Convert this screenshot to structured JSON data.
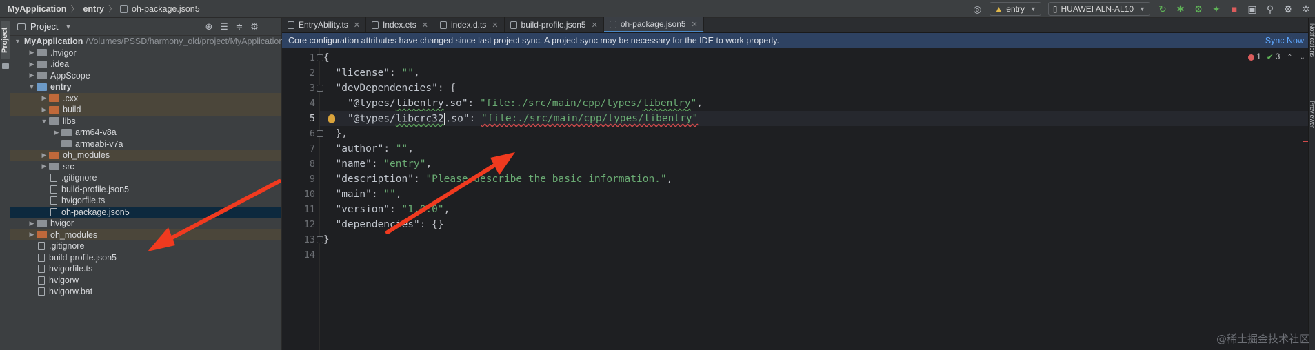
{
  "breadcrumb": {
    "project": "MyApplication",
    "module": "entry",
    "file": "oh-package.json5"
  },
  "toolbar": {
    "module_select": "entry",
    "device_select": "HUAWEI ALN-AL10"
  },
  "side_strip": {
    "label": "Project"
  },
  "project_panel": {
    "title": "Project"
  },
  "tree": [
    {
      "indent": 0,
      "arrow": "down",
      "icon": "folder-b",
      "label": "MyApplication",
      "path": "/Volumes/PSSD/harmony_old/project/MyApplication",
      "bold": true,
      "state": ""
    },
    {
      "indent": 1,
      "arrow": "right",
      "icon": "folder",
      "label": ".hvigor",
      "state": ""
    },
    {
      "indent": 1,
      "arrow": "right",
      "icon": "folder",
      "label": ".idea",
      "state": ""
    },
    {
      "indent": 1,
      "arrow": "right",
      "icon": "folder",
      "label": "AppScope",
      "state": ""
    },
    {
      "indent": 1,
      "arrow": "down",
      "icon": "folder-b",
      "label": "entry",
      "bold": true,
      "state": ""
    },
    {
      "indent": 2,
      "arrow": "right",
      "icon": "folder-o",
      "label": ".cxx",
      "state": "hl"
    },
    {
      "indent": 2,
      "arrow": "right",
      "icon": "folder-o",
      "label": "build",
      "state": "hl"
    },
    {
      "indent": 2,
      "arrow": "down",
      "icon": "folder",
      "label": "libs",
      "state": ""
    },
    {
      "indent": 3,
      "arrow": "right",
      "icon": "folder",
      "label": "arm64-v8a",
      "state": ""
    },
    {
      "indent": 3,
      "arrow": "",
      "icon": "folder",
      "label": "armeabi-v7a",
      "state": ""
    },
    {
      "indent": 2,
      "arrow": "right",
      "icon": "folder-o",
      "label": "oh_modules",
      "state": "hl"
    },
    {
      "indent": 2,
      "arrow": "right",
      "icon": "folder",
      "label": "src",
      "state": ""
    },
    {
      "indent": 2,
      "arrow": "",
      "icon": "file",
      "label": ".gitignore",
      "state": ""
    },
    {
      "indent": 2,
      "arrow": "",
      "icon": "file",
      "label": "build-profile.json5",
      "state": ""
    },
    {
      "indent": 2,
      "arrow": "",
      "icon": "file",
      "label": "hvigorfile.ts",
      "state": ""
    },
    {
      "indent": 2,
      "arrow": "",
      "icon": "file",
      "label": "oh-package.json5",
      "state": "sel"
    },
    {
      "indent": 1,
      "arrow": "right",
      "icon": "folder",
      "label": "hvigor",
      "state": ""
    },
    {
      "indent": 1,
      "arrow": "right",
      "icon": "folder-o",
      "label": "oh_modules",
      "state": "hl"
    },
    {
      "indent": 1,
      "arrow": "",
      "icon": "file",
      "label": ".gitignore",
      "state": ""
    },
    {
      "indent": 1,
      "arrow": "",
      "icon": "file",
      "label": "build-profile.json5",
      "state": ""
    },
    {
      "indent": 1,
      "arrow": "",
      "icon": "file",
      "label": "hvigorfile.ts",
      "state": ""
    },
    {
      "indent": 1,
      "arrow": "",
      "icon": "file",
      "label": "hvigorw",
      "state": ""
    },
    {
      "indent": 1,
      "arrow": "",
      "icon": "file",
      "label": "hvigorw.bat",
      "state": ""
    }
  ],
  "tabs": [
    {
      "label": "EntryAbility.ts",
      "active": false
    },
    {
      "label": "Index.ets",
      "active": false
    },
    {
      "label": "index.d.ts",
      "active": false
    },
    {
      "label": "build-profile.json5",
      "active": false
    },
    {
      "label": "oh-package.json5",
      "active": true
    }
  ],
  "banner": {
    "message": "Core configuration attributes have changed since last project sync. A project sync may be necessary for the IDE to work properly.",
    "action": "Sync Now"
  },
  "inspections": {
    "errors": "1",
    "ok": "3"
  },
  "code_lines": [
    {
      "n": "1",
      "text": "{"
    },
    {
      "n": "2",
      "text": "  \"license\": \"\","
    },
    {
      "n": "3",
      "text": "  \"devDependencies\": {"
    },
    {
      "n": "4",
      "text": "    \"@types/libentry.so\": \"file:./src/main/cpp/types/libentry\","
    },
    {
      "n": "5",
      "text": "    \"@types/libcrc32.so\": \"file:./src/main/cpp/types/libentry\""
    },
    {
      "n": "6",
      "text": "  },"
    },
    {
      "n": "7",
      "text": "  \"author\": \"\","
    },
    {
      "n": "8",
      "text": "  \"name\": \"entry\","
    },
    {
      "n": "9",
      "text": "  \"description\": \"Please describe the basic information.\","
    },
    {
      "n": "10",
      "text": "  \"main\": \"\","
    },
    {
      "n": "11",
      "text": "  \"version\": \"1.0.0\","
    },
    {
      "n": "12",
      "text": "  \"dependencies\": {}"
    },
    {
      "n": "13",
      "text": "}"
    },
    {
      "n": "14",
      "text": ""
    }
  ],
  "right_strip": {
    "notifications": "Notifications",
    "previewer": "Previewer"
  },
  "watermark": "@稀土掘金技术社区",
  "colors": {
    "annotation_arrow": "#f03a1f",
    "accent": "#4a88c7"
  }
}
